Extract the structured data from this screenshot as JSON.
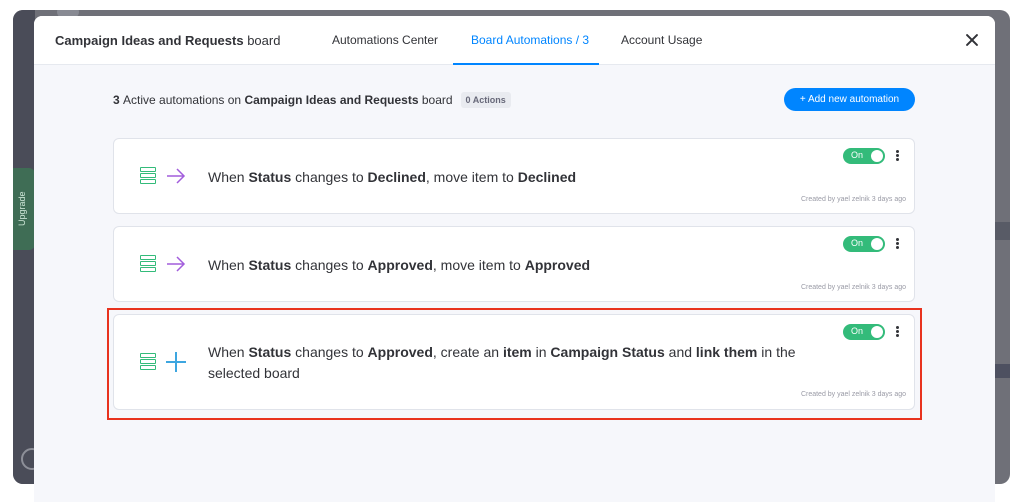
{
  "header": {
    "board_name": "Campaign Ideas and Requests",
    "board_suffix": "board",
    "tabs": [
      {
        "label": "Automations Center"
      },
      {
        "label": "Board Automations / 3"
      },
      {
        "label": "Account Usage"
      }
    ],
    "active_tab": "Board Automations / 3"
  },
  "sidebar": {
    "upgrade_label": "Upgrade"
  },
  "summary": {
    "count": "3",
    "text_before": "Active automations on",
    "board_name": "Campaign Ideas and Requests",
    "text_after": "board",
    "badge": "0 Actions"
  },
  "add_button": {
    "label": "+ Add new automation"
  },
  "automations": [
    {
      "icons": [
        "list-icon",
        "arrow-icon"
      ],
      "toggle_label": "On",
      "enabled": true,
      "created": "Created by yael zelnik 3 days ago",
      "parts": [
        "When ",
        "Status",
        " changes to ",
        "Declined",
        ", move item to ",
        "Declined",
        "",
        "",
        "",
        "",
        "",
        ""
      ]
    },
    {
      "icons": [
        "list-icon",
        "arrow-icon"
      ],
      "toggle_label": "On",
      "enabled": true,
      "created": "Created by yael zelnik 3 days ago",
      "parts": [
        "When ",
        "Status",
        " changes to ",
        "Approved",
        ", move item to ",
        "Approved",
        "",
        "",
        "",
        "",
        "",
        ""
      ]
    },
    {
      "icons": [
        "list-icon",
        "plus-icon"
      ],
      "toggle_label": "On",
      "enabled": true,
      "created": "Created by yael zelnik 3 days ago",
      "parts": [
        "When ",
        "Status",
        " changes to ",
        "Approved",
        ", create an ",
        "item",
        " in ",
        "Campaign Status",
        " and ",
        "link them",
        " in the selected board",
        ""
      ]
    }
  ],
  "colors": {
    "accent": "#0085ff",
    "toggle_on": "#33bb7a",
    "highlight": "#e8321e",
    "text": "#323338"
  }
}
